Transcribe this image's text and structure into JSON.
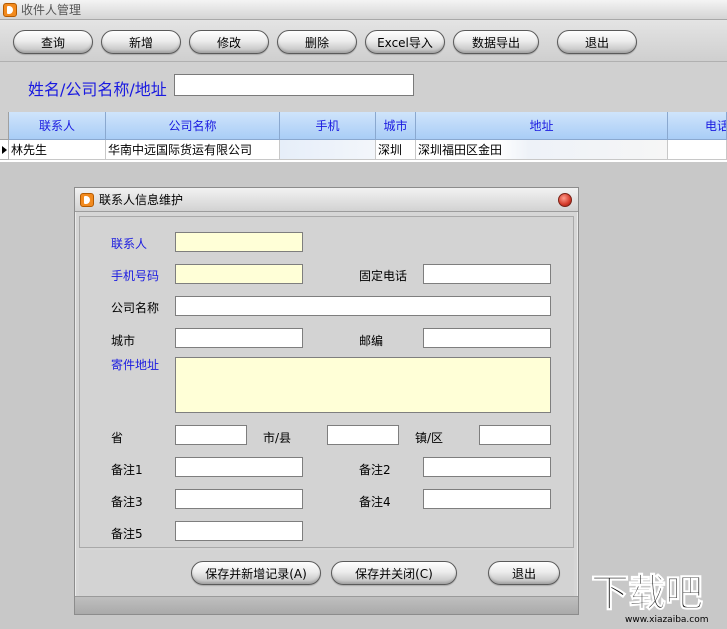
{
  "window": {
    "title": "收件人管理"
  },
  "toolbar": {
    "query": "查询",
    "add": "新增",
    "edit": "修改",
    "delete": "删除",
    "excel_import": "Excel导入",
    "export": "数据导出",
    "exit": "退出"
  },
  "search": {
    "label": "姓名/公司名称/地址",
    "value": ""
  },
  "grid": {
    "columns": [
      "联系人",
      "公司名称",
      "手机",
      "城市",
      "地址",
      "电话"
    ],
    "rows": [
      {
        "contact": "林先生",
        "company": "华南中远国际货运有限公司",
        "mobile": "",
        "city": "深圳",
        "address": "深圳福田区金田",
        "phone": ""
      }
    ]
  },
  "dialog": {
    "title": "联系人信息维护",
    "labels": {
      "contact": "联系人",
      "mobile": "手机号码",
      "landline": "固定电话",
      "company": "公司名称",
      "city": "城市",
      "postcode": "邮编",
      "address": "寄件地址",
      "province": "省",
      "city_county": "市/县",
      "town_district": "镇/区",
      "note1": "备注1",
      "note2": "备注2",
      "note3": "备注3",
      "note4": "备注4",
      "note5": "备注5"
    },
    "buttons": {
      "save_new": "保存并新增记录(A)",
      "save_close": "保存并关闭(C)",
      "exit": "退出"
    }
  },
  "watermark": {
    "main": "下载吧",
    "url": "www.xiazaiba.com"
  },
  "colors": {
    "label_blue": "#1a1ae0",
    "header_blue": "#a9cdf6",
    "required_field": "#ffffd7"
  }
}
